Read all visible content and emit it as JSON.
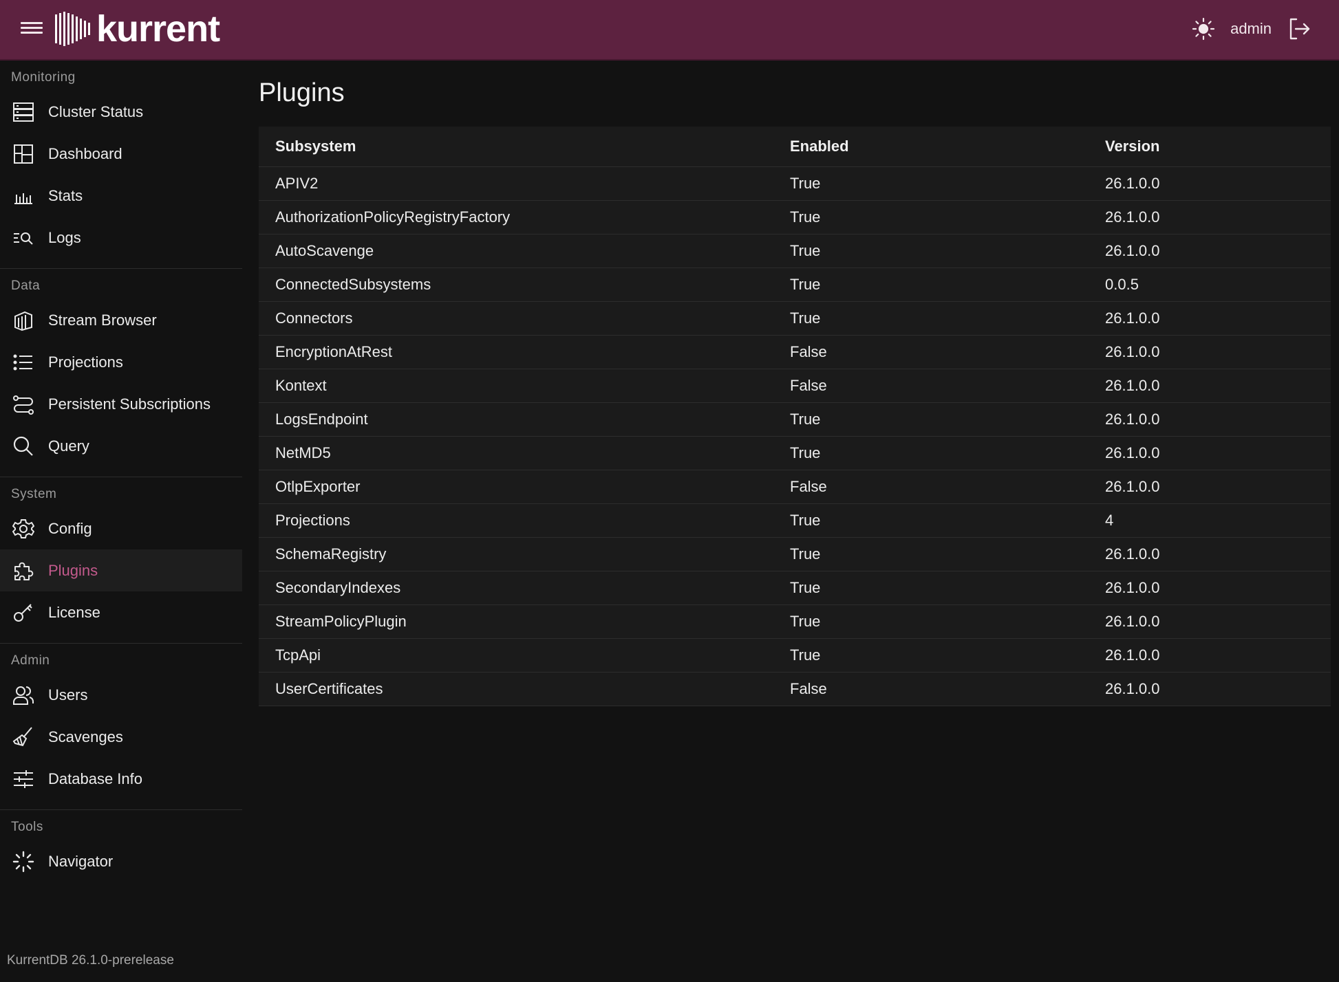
{
  "header": {
    "brand": "kurrent",
    "username": "admin",
    "theme_icon": "sun-icon",
    "logout_icon": "logout-icon",
    "bg_color": "#5d2240"
  },
  "sidebar": {
    "sections": [
      {
        "title": "Monitoring",
        "items": [
          {
            "label": "Cluster Status",
            "icon": "server-icon"
          },
          {
            "label": "Dashboard",
            "icon": "dashboard-icon"
          },
          {
            "label": "Stats",
            "icon": "bar-chart-icon"
          },
          {
            "label": "Logs",
            "icon": "log-search-icon"
          }
        ]
      },
      {
        "title": "Data",
        "items": [
          {
            "label": "Stream Browser",
            "icon": "stream-icon"
          },
          {
            "label": "Projections",
            "icon": "list-icon"
          },
          {
            "label": "Persistent Subscriptions",
            "icon": "route-icon"
          },
          {
            "label": "Query",
            "icon": "search-icon"
          }
        ]
      },
      {
        "title": "System",
        "items": [
          {
            "label": "Config",
            "icon": "gear-icon"
          },
          {
            "label": "Plugins",
            "icon": "puzzle-icon",
            "active": true
          },
          {
            "label": "License",
            "icon": "key-icon"
          }
        ]
      },
      {
        "title": "Admin",
        "items": [
          {
            "label": "Users",
            "icon": "users-icon"
          },
          {
            "label": "Scavenges",
            "icon": "broom-icon"
          },
          {
            "label": "Database Info",
            "icon": "sliders-icon"
          }
        ]
      },
      {
        "title": "Tools",
        "items": [
          {
            "label": "Navigator",
            "icon": "navigator-icon"
          }
        ]
      }
    ],
    "active_color": "#c35a8c",
    "footer_version": "KurrentDB 26.1.0-prerelease"
  },
  "main": {
    "title": "Plugins",
    "columns": [
      "Subsystem",
      "Enabled",
      "Version"
    ],
    "rows": [
      [
        "APIV2",
        "True",
        "26.1.0.0"
      ],
      [
        "AuthorizationPolicyRegistryFactory",
        "True",
        "26.1.0.0"
      ],
      [
        "AutoScavenge",
        "True",
        "26.1.0.0"
      ],
      [
        "ConnectedSubsystems",
        "True",
        "0.0.5"
      ],
      [
        "Connectors",
        "True",
        "26.1.0.0"
      ],
      [
        "EncryptionAtRest",
        "False",
        "26.1.0.0"
      ],
      [
        "Kontext",
        "False",
        "26.1.0.0"
      ],
      [
        "LogsEndpoint",
        "True",
        "26.1.0.0"
      ],
      [
        "NetMD5",
        "True",
        "26.1.0.0"
      ],
      [
        "OtlpExporter",
        "False",
        "26.1.0.0"
      ],
      [
        "Projections",
        "True",
        "4"
      ],
      [
        "SchemaRegistry",
        "True",
        "26.1.0.0"
      ],
      [
        "SecondaryIndexes",
        "True",
        "26.1.0.0"
      ],
      [
        "StreamPolicyPlugin",
        "True",
        "26.1.0.0"
      ],
      [
        "TcpApi",
        "True",
        "26.1.0.0"
      ],
      [
        "UserCertificates",
        "False",
        "26.1.0.0"
      ]
    ]
  }
}
